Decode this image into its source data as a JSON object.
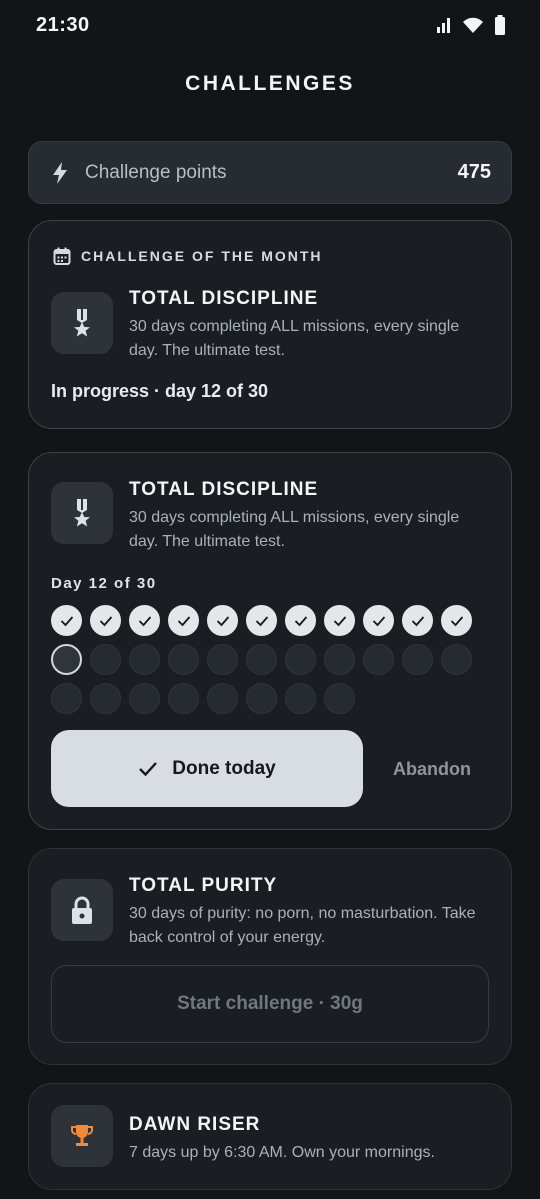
{
  "status": {
    "time": "21:30"
  },
  "header": {
    "title": "CHALLENGES"
  },
  "points": {
    "label": "Challenge points",
    "value": "475"
  },
  "month_card": {
    "section_label": "CHALLENGE OF THE MONTH",
    "title": "TOTAL DISCIPLINE",
    "description": "30 days completing ALL missions, every single day. The ultimate test.",
    "progress": "In progress · day 12 of 30",
    "icon": "medal-icon"
  },
  "active_card": {
    "title": "TOTAL DISCIPLINE",
    "description": "30 days completing ALL missions, every single day. The ultimate test.",
    "day_label": "Day 12 of 30",
    "days_completed": 11,
    "current_day": 12,
    "total_days": 30,
    "done_label": "Done today",
    "abandon_label": "Abandon",
    "icon": "medal-icon"
  },
  "purity_card": {
    "title": "TOTAL PURITY",
    "description": "30 days of purity: no porn, no masturbation. Take back control of your energy.",
    "start_label": "Start challenge · 30g",
    "icon": "lock-icon"
  },
  "dawn_card": {
    "title": "DAWN RISER",
    "description": "7 days up by 6:30 AM. Own your mornings.",
    "icon": "trophy-icon",
    "icon_color": "#f08a3c"
  }
}
